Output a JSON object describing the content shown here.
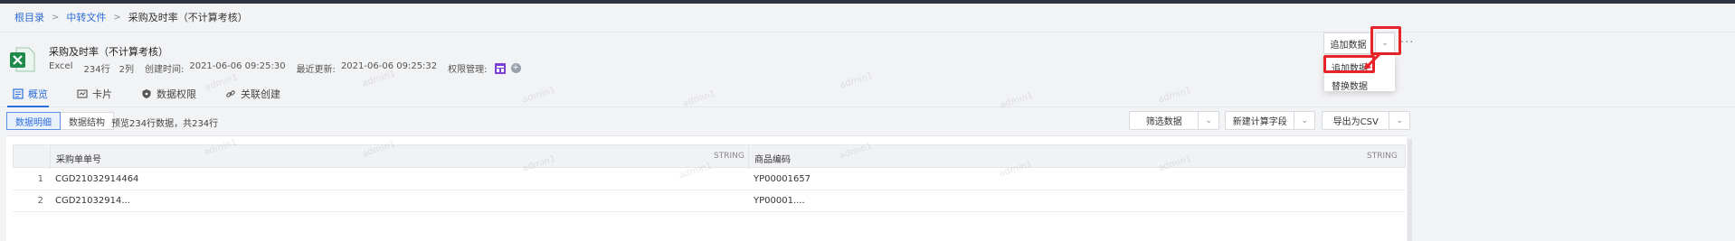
{
  "breadcrumb": {
    "items": [
      "根目录",
      "中转文件"
    ],
    "current": "采购及时率（不计算考核）",
    "separator": ">"
  },
  "file": {
    "title": "采购及时率（不计算考核）",
    "type": "Excel",
    "rows": "234行",
    "cols": "2列",
    "created_label": "创建时间:",
    "created_value": "2021-06-06 09:25:30",
    "updated_label": "最近更新:",
    "updated_value": "2021-06-06 09:25:32",
    "perm_label": "权限管理:",
    "add_symbol": "+"
  },
  "actions": {
    "append_button": "追加数据",
    "more": "···"
  },
  "dropdown": {
    "items": [
      "追加数据",
      "替换数据"
    ]
  },
  "tabs": [
    {
      "label": "概览",
      "icon": "overview-icon"
    },
    {
      "label": "卡片",
      "icon": "card-icon"
    },
    {
      "label": "数据权限",
      "icon": "shield-icon"
    },
    {
      "label": "关联创建",
      "icon": "link-icon"
    }
  ],
  "toolbar": {
    "view_detail": "数据明细",
    "view_structure": "数据结构",
    "preview_text": "预览234行数据，共234行",
    "filter": "筛选数据",
    "calc_field": "新建计算字段",
    "export": "导出为CSV"
  },
  "table": {
    "columns": [
      {
        "name": "采购单单号",
        "type": "STRING"
      },
      {
        "name": "商品编码",
        "type": "STRING"
      }
    ],
    "rows": [
      {
        "num": "1",
        "cells": [
          "CGD21032914464",
          "YP00001657"
        ]
      },
      {
        "num": "2",
        "cells": [
          "CGD21032914...",
          "YP00001...."
        ]
      }
    ]
  },
  "watermark": "admin1",
  "colors": {
    "accent": "#2d6ed8",
    "highlight": "#e8242a",
    "excel_green": "#1f8a4c"
  }
}
